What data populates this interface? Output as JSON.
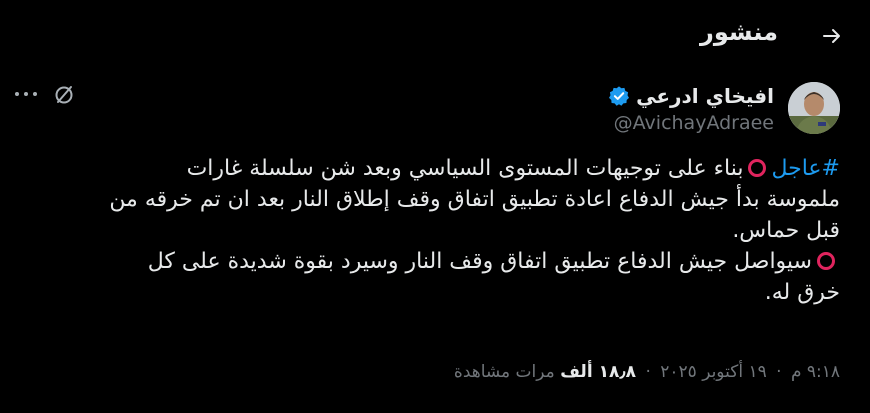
{
  "header": {
    "title": "منشور"
  },
  "author": {
    "name": "افيخاي ادرعي",
    "handle": "@AvichayAdraee"
  },
  "post": {
    "hashtag": "#عاجل",
    "line1_text": "بناء على توجيهات المستوى السياسي وبعد شن سلسلة غارات",
    "line2": "ملموسة بدأ جيش الدفاع اعادة تطبيق اتفاق وقف إطلاق النار بعد ان تم خرقه من",
    "line3": "قبل حماس.",
    "line4_text": "سيواصل جيش الدفاع تطبيق اتفاق وقف النار وسيرد بقوة شديدة على كل",
    "line5": "خرق له."
  },
  "meta": {
    "time": "٩:١٨ م",
    "date": "١٩ أكتوبر ٢٠٢٥",
    "separator": "·",
    "views_count": "١٨٫٨ ألف",
    "views_label": "مرات مشاهدة"
  },
  "colors": {
    "background": "#000000",
    "text": "#e7e9ea",
    "muted": "#71767b",
    "link": "#1d9bf0",
    "verified": "#1d9bf0",
    "emoji_red": "#e0245e"
  },
  "icons": {
    "back": "arrow-right-icon",
    "verified": "verified-badge-icon",
    "more": "more-horizontal-icon",
    "grok": "grok-icon",
    "emoji": "red-circle-icon"
  }
}
